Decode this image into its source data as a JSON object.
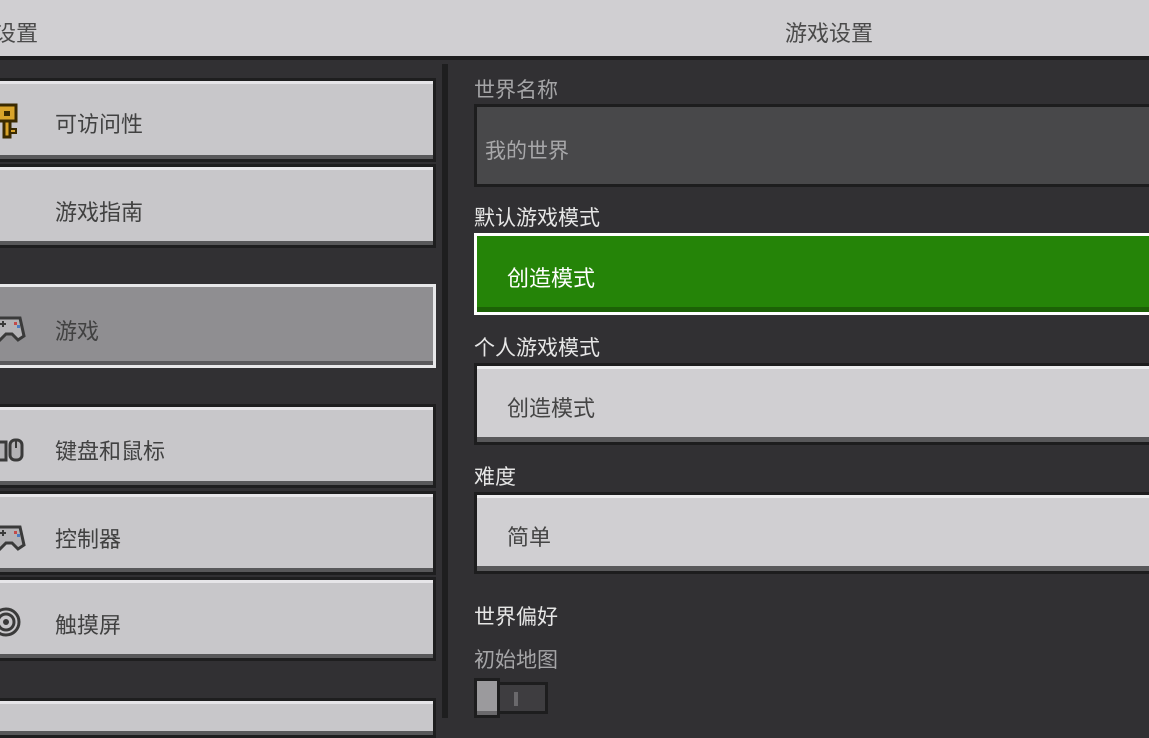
{
  "header": {
    "left_title": "设置",
    "center_title": "游戏设置"
  },
  "sidebar": {
    "items": [
      {
        "label": "可访问性",
        "icon": "key-icon",
        "active": false
      },
      {
        "label": "游戏指南",
        "icon": "",
        "active": false
      },
      {
        "label": "游戏",
        "icon": "controller-icon",
        "active": true
      },
      {
        "label": "键盘和鼠标",
        "icon": "keyboard-mouse-icon",
        "active": false
      },
      {
        "label": "控制器",
        "icon": "controller-icon",
        "active": false
      },
      {
        "label": "触摸屏",
        "icon": "touch-icon",
        "active": false
      }
    ]
  },
  "main": {
    "world_name_label": "世界名称",
    "world_name_value": "我的世界",
    "default_mode_label": "默认游戏模式",
    "default_mode_value": "创造模式",
    "personal_mode_label": "个人游戏模式",
    "personal_mode_value": "创造模式",
    "difficulty_label": "难度",
    "difficulty_value": "简单",
    "world_prefs_label": "世界偏好",
    "starting_map_label": "初始地图",
    "starting_map_on": false
  },
  "colors": {
    "accent_green": "#258408",
    "panel_bg": "#313033",
    "button_bg": "#c8c7ca"
  }
}
